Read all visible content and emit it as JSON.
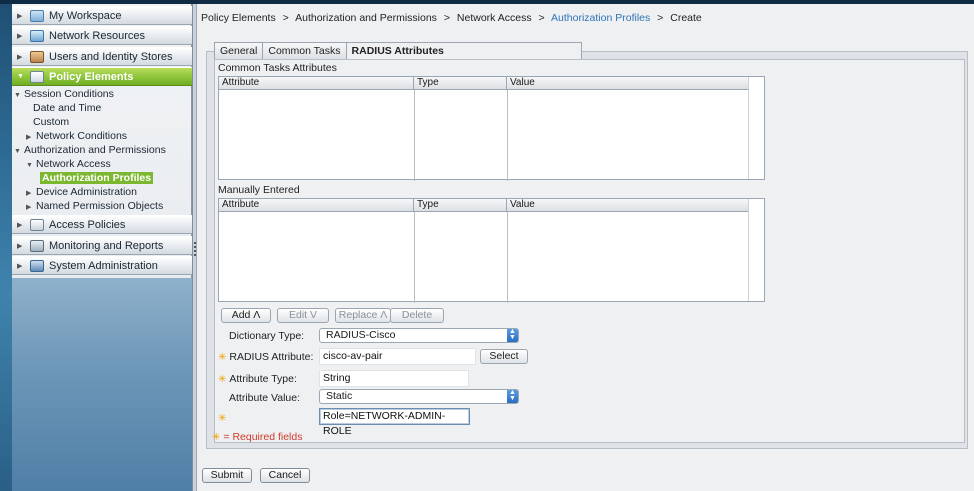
{
  "breadcrumb": {
    "part1": "Policy Elements",
    "part2": "Authorization and Permissions",
    "part3": "Network Access",
    "part4": "Authorization Profiles",
    "part5": "Create",
    "sep": ">"
  },
  "sidebar": {
    "drawers": [
      {
        "label": "My Workspace",
        "icon": "workspace-icon"
      },
      {
        "label": "Network Resources",
        "icon": "network-resources-icon"
      },
      {
        "label": "Users and Identity Stores",
        "icon": "users-icon"
      },
      {
        "label": "Policy Elements",
        "icon": "policy-elements-icon"
      },
      {
        "label": "Access Policies",
        "icon": "access-policies-icon"
      },
      {
        "label": "Monitoring and Reports",
        "icon": "monitoring-icon"
      },
      {
        "label": "System Administration",
        "icon": "system-admin-icon"
      }
    ],
    "tree": {
      "session_conditions": "Session Conditions",
      "date_time": "Date and Time",
      "custom": "Custom",
      "network_conditions": "Network Conditions",
      "authz_permissions": "Authorization and Permissions",
      "network_access": "Network Access",
      "authz_profiles": "Authorization Profiles",
      "device_admin": "Device Administration",
      "named_permission_objects": "Named Permission Objects"
    }
  },
  "tabs": {
    "general": "General",
    "common_tasks": "Common Tasks",
    "radius_attributes": "RADIUS Attributes"
  },
  "common_tasks_grid": {
    "title": "Common Tasks Attributes",
    "columns": [
      "Attribute",
      "Type",
      "Value"
    ]
  },
  "manual_grid": {
    "title": "Manually Entered",
    "columns": [
      "Attribute",
      "Type",
      "Value"
    ]
  },
  "grid_buttons": {
    "add": "Add Λ",
    "edit": "Edit V",
    "replace": "Replace Λ",
    "delete": "Delete"
  },
  "form": {
    "dictionary_type_label": "Dictionary Type:",
    "dictionary_type_value": "RADIUS-Cisco",
    "radius_attribute_label": "RADIUS Attribute:",
    "radius_attribute_value": "cisco-av-pair",
    "select_button": "Select",
    "attribute_type_label": "Attribute Type:",
    "attribute_type_value": "String",
    "attribute_value_label": "Attribute Value:",
    "attribute_value_value": "Static",
    "value_field": "Role=NETWORK-ADMIN-ROLE",
    "required_note": "= Required fields"
  },
  "footer": {
    "submit": "Submit",
    "cancel": "Cancel"
  },
  "colors": {
    "active_drawer": "#8cc43a",
    "link": "#2f73b8",
    "required": "#d03a2a",
    "required_star": "#f0a000"
  }
}
